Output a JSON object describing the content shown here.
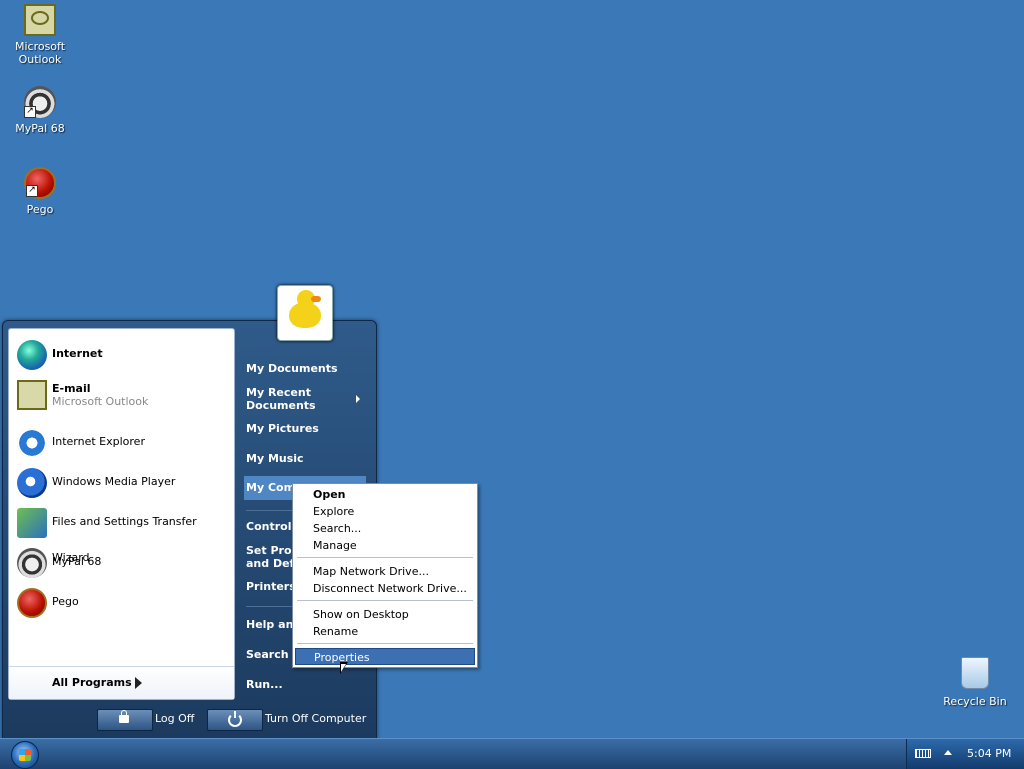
{
  "desktop": {
    "icons": [
      {
        "label": "Microsoft\nOutlook",
        "icon": "outlook-icon"
      },
      {
        "label": "MyPal 68",
        "icon": "mypal-icon"
      },
      {
        "label": "Pego",
        "icon": "pego-icon"
      },
      {
        "label": "Recycle Bin",
        "icon": "recycle-bin-icon"
      }
    ]
  },
  "start_menu": {
    "programs": [
      {
        "label": "Internet",
        "bold": true,
        "icon": "globe-icon"
      },
      {
        "label": "E-mail",
        "sub": "Microsoft Outlook",
        "bold": true,
        "icon": "outlook-mail-icon"
      },
      {
        "label": "Internet Explorer",
        "icon": "internet-explorer-icon"
      },
      {
        "label": "Windows Media Player",
        "icon": "windows-media-player-icon"
      },
      {
        "label": "Files and Settings Transfer Wizard",
        "icon": "transfer-wizard-icon"
      },
      {
        "label": "MyPal 68",
        "icon": "mypal-icon"
      },
      {
        "label": "Pego",
        "icon": "pego-icon"
      }
    ],
    "all_programs": "All Programs",
    "places": [
      {
        "label": "My Documents"
      },
      {
        "label": "My Recent\nDocuments",
        "has_submenu": true
      },
      {
        "label": "My Pictures"
      },
      {
        "label": "My Music"
      },
      {
        "label": "My Comp"
      },
      {
        "label": "Control P"
      },
      {
        "label": "Set Progr\nand Defa"
      },
      {
        "label": "Printers a"
      },
      {
        "label": "Help and"
      },
      {
        "label": "Search"
      },
      {
        "label": "Run..."
      }
    ],
    "log_off": "Log Off",
    "turn_off": "Turn Off Computer"
  },
  "context_menu": {
    "items": [
      "Open",
      "Explore",
      "Search...",
      "Manage",
      "Map Network Drive...",
      "Disconnect Network Drive...",
      "Show on Desktop",
      "Rename",
      "Properties"
    ],
    "default_item": "Open",
    "selected_item": "Properties"
  },
  "taskbar": {
    "clock": "5:04 PM"
  },
  "colors": {
    "desktop": "#3b78b8",
    "selection": "#3d6fb3",
    "start_menu": "#1c3a5e"
  }
}
